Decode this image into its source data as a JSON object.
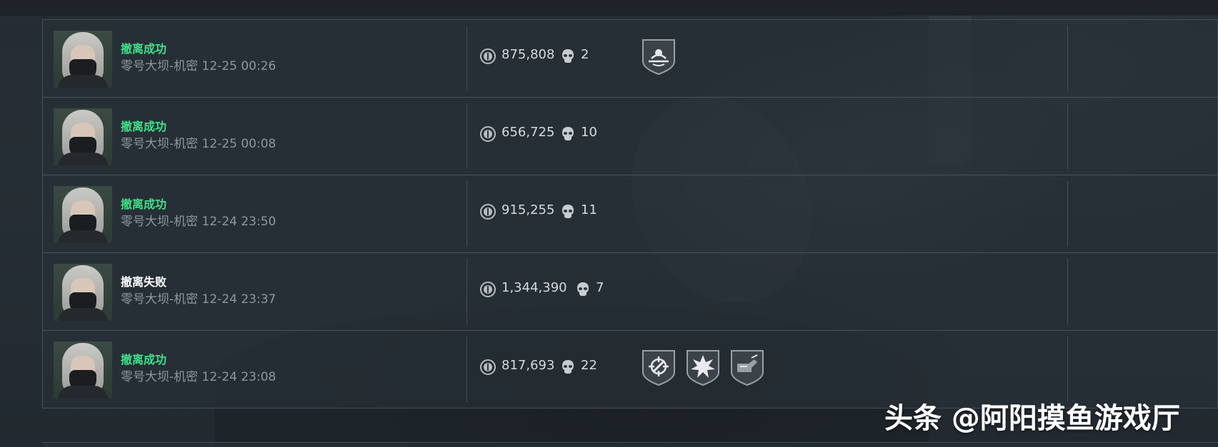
{
  "records": [
    {
      "status": "撤离成功",
      "status_type": "success",
      "map": "零号大坝-机密",
      "time": "12-25 00:26",
      "value": "875,808",
      "kills": "2",
      "badges": [
        "extraction-badge-icon"
      ]
    },
    {
      "status": "撤离成功",
      "status_type": "success",
      "map": "零号大坝-机密",
      "time": "12-25 00:08",
      "value": "656,725",
      "kills": "10",
      "badges": []
    },
    {
      "status": "撤离成功",
      "status_type": "success",
      "map": "零号大坝-机密",
      "time": "12-24 23:50",
      "value": "915,255",
      "kills": "11",
      "badges": []
    },
    {
      "status": "撤离失败",
      "status_type": "fail",
      "map": "零号大坝-机密",
      "time": "12-24 23:37",
      "value": "1,344,390",
      "kills": "7",
      "badges": []
    },
    {
      "status": "撤离成功",
      "status_type": "success",
      "map": "零号大坝-机密",
      "time": "12-24 23:08",
      "value": "817,693",
      "kills": "22",
      "badges": [
        "crosshair-badge-icon",
        "explosion-badge-icon",
        "breach-badge-icon"
      ]
    }
  ],
  "watermark": "头条 @阿阳摸鱼游戏厅",
  "colors": {
    "success": "#3fe089",
    "fail": "#ffffff",
    "meta": "#8f969d",
    "value": "#d6dadd"
  }
}
